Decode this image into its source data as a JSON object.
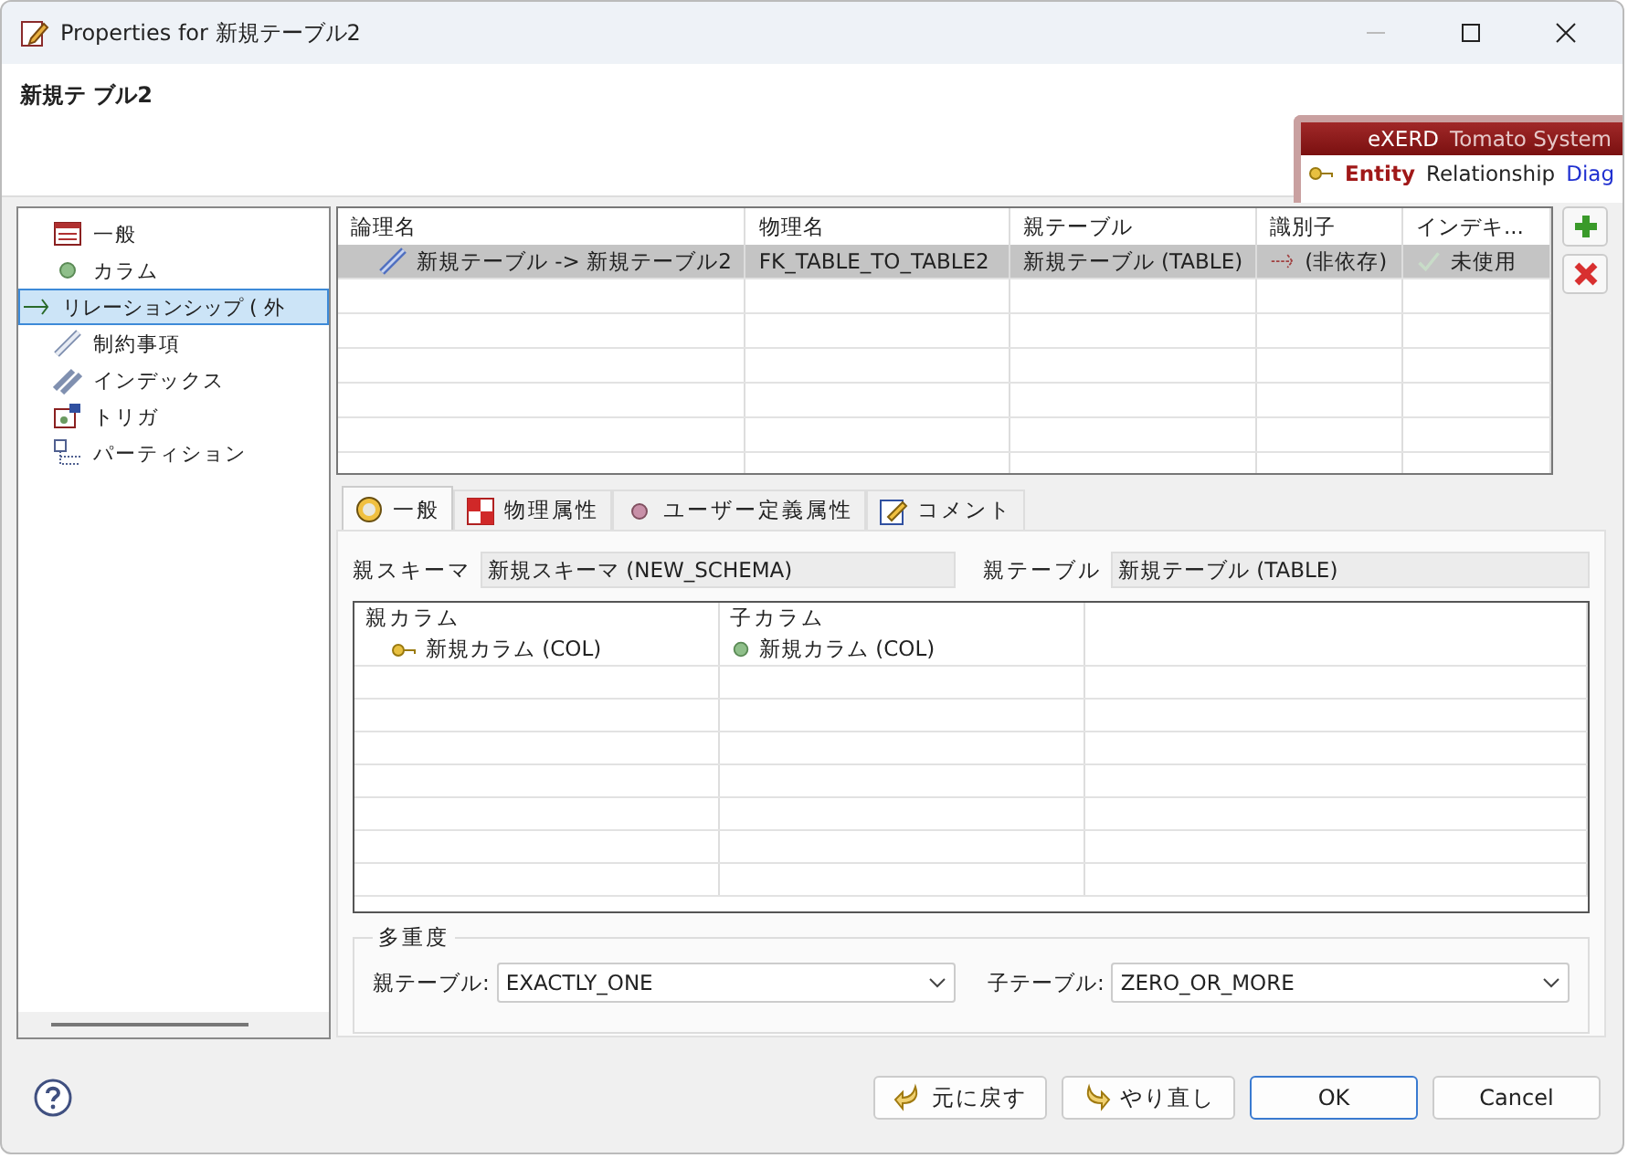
{
  "window": {
    "title": "Properties for 新規テーブル2"
  },
  "header": {
    "title": "新規テ ブル2",
    "banner": {
      "product": "eXERD",
      "subtitle": "Tomato System",
      "tabs": [
        {
          "label": "Entity",
          "selected": true
        },
        {
          "label": "Relationship",
          "selected": false
        },
        {
          "label": "Diag",
          "selected": false
        }
      ]
    }
  },
  "sidebar": {
    "items": [
      {
        "label": "一般",
        "kind": "table",
        "selected": false
      },
      {
        "label": "カラム",
        "kind": "dot",
        "selected": false
      },
      {
        "label": "リレーションシップ ( 外",
        "kind": "relation",
        "selected": true
      },
      {
        "label": "制約事項",
        "kind": "link",
        "selected": false
      },
      {
        "label": "インデックス",
        "kind": "links",
        "selected": false
      },
      {
        "label": "トリガ",
        "kind": "trigger",
        "selected": false
      },
      {
        "label": "パーティション",
        "kind": "partition",
        "selected": false
      }
    ]
  },
  "relations_table": {
    "columns": [
      "論理名",
      "物理名",
      "親テーブル",
      "識別子",
      "インデキ..."
    ],
    "rows": [
      {
        "selected": true,
        "cells": [
          "新規テーブル -> 新規テーブル2",
          "FK_TABLE_TO_TABLE2",
          "新規テーブル (TABLE)",
          "(非依存)",
          "未使用"
        ]
      }
    ]
  },
  "detail_tabs": [
    {
      "label": "一般",
      "kind": "general",
      "selected": true
    },
    {
      "label": "物理属性",
      "kind": "physical",
      "selected": false
    },
    {
      "label": "ユーザー定義属性",
      "kind": "user",
      "selected": false
    },
    {
      "label": "コメント",
      "kind": "comment",
      "selected": false
    }
  ],
  "general": {
    "parent_schema": {
      "label": "親スキーマ",
      "value": "新規スキーマ (NEW_SCHEMA)"
    },
    "parent_table": {
      "label": "親テーブル",
      "value": "新規テーブル (TABLE)"
    },
    "columns_table": {
      "columns": [
        "親カラム",
        "子カラム"
      ],
      "rows": [
        [
          "新規カラム (COL)",
          "新規カラム (COL)"
        ]
      ]
    },
    "multiplicity": {
      "title": "多重度",
      "parent": {
        "label": "親テーブル:",
        "value": "EXACTLY_ONE"
      },
      "child": {
        "label": "子テーブル:",
        "value": "ZERO_OR_MORE"
      }
    }
  },
  "buttons": [
    {
      "label": "元に戻す",
      "kind": "undo"
    },
    {
      "label": "やり直し",
      "kind": "redo"
    },
    {
      "label": "OK",
      "kind": "default"
    },
    {
      "label": "Cancel",
      "kind": "plain"
    }
  ]
}
